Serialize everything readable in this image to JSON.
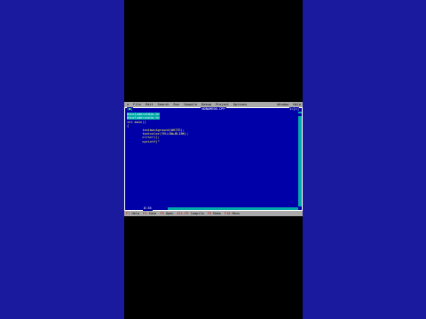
{
  "menu": {
    "system": "≡",
    "items": [
      "File",
      "Edit",
      "Search",
      "Run",
      "Compile",
      "Debug",
      "Project",
      "Options",
      "Window",
      "Help"
    ]
  },
  "editor": {
    "close_glyph": "[■]",
    "title": "NONAME00.CPP",
    "window_number": "1=[↕]",
    "lines": [
      {
        "text": "#include<stdio.h>",
        "selected": true
      },
      {
        "text": "#include<conio.h>",
        "selected": true
      },
      {
        "text": "int main()",
        "selected": false
      },
      {
        "text": "{",
        "selected": false
      },
      {
        "text": "        textbackground(WHITE);",
        "selected": false
      },
      {
        "text": "        textcolor(YELLOW+BLINK);",
        "selected": false
      },
      {
        "text": "        clrscr();",
        "selected": false
      },
      {
        "text": "        cprintf(\"",
        "selected": false
      }
    ],
    "cursor_position": "8:35"
  },
  "fkeys": [
    {
      "key": "F1",
      "label": "Help"
    },
    {
      "key": "F2",
      "label": "Save"
    },
    {
      "key": "F3",
      "label": "Open"
    },
    {
      "key": "Alt-F9",
      "label": "Compile"
    },
    {
      "key": "F9",
      "label": "Make"
    },
    {
      "key": "F10",
      "label": "Menu"
    }
  ],
  "colors": {
    "desktop": "#0000a8",
    "menu_bg": "#aaaaaa",
    "selection": "#00aaaa",
    "code_text": "#ffff55",
    "hotkey": "#aa0000"
  }
}
